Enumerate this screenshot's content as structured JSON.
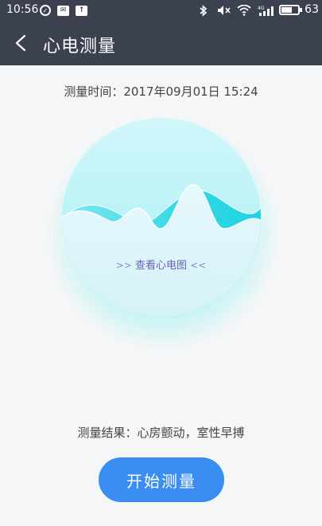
{
  "status_bar": {
    "time": "10:56",
    "battery": "63",
    "battery_level": 0.63,
    "icons": [
      "alarm-check-icon",
      "mail-icon",
      "upload-icon",
      "bluetooth-icon",
      "mute-icon",
      "wifi-icon",
      "4g-signal-icon",
      "battery-icon"
    ]
  },
  "header": {
    "back_icon": "chevron-left-icon",
    "title": "心电测量"
  },
  "measurement": {
    "time_text": "测量时间：2017年09月01日 15:24",
    "view_chart_label": "查看心电图",
    "result_text": "测量结果：心房颤动，室性早搏"
  },
  "actions": {
    "start_label": "开始测量"
  },
  "colors": {
    "header_bg": "#3c4150",
    "accent_button": "#3a8ef2",
    "circle_top": "#a6f1f5",
    "circle_wave": "#15d3df",
    "link_color": "#6a5fb5"
  }
}
